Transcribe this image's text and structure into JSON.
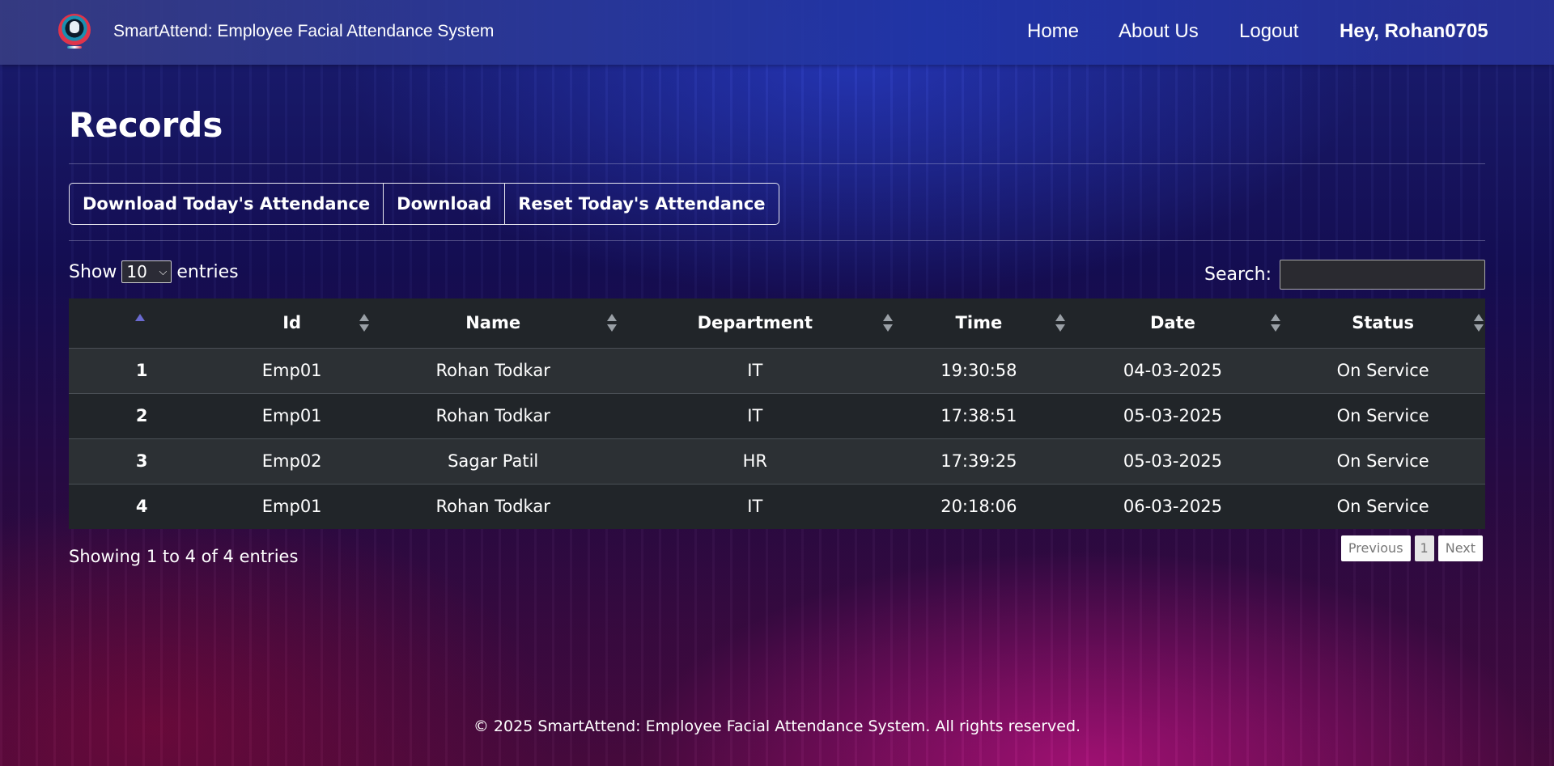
{
  "nav": {
    "brand": "SmartAttend: Employee Facial Attendance System",
    "links": [
      "Home",
      "About Us",
      "Logout"
    ],
    "greeting": "Hey, Rohan0705"
  },
  "page": {
    "title": "Records"
  },
  "actions": {
    "download_today": "Download Today's Attendance",
    "download": "Download",
    "reset_today": "Reset Today's Attendance"
  },
  "table_controls": {
    "show_label": "Show",
    "entries_value": "10",
    "entries_label": "entries",
    "search_label": "Search:"
  },
  "table": {
    "columns": [
      "",
      "Id",
      "Name",
      "Department",
      "Time",
      "Date",
      "Status"
    ],
    "rows": [
      [
        "1",
        "Emp01",
        "Rohan Todkar",
        "IT",
        "19:30:58",
        "04-03-2025",
        "On Service"
      ],
      [
        "2",
        "Emp01",
        "Rohan Todkar",
        "IT",
        "17:38:51",
        "05-03-2025",
        "On Service"
      ],
      [
        "3",
        "Emp02",
        "Sagar Patil",
        "HR",
        "17:39:25",
        "05-03-2025",
        "On Service"
      ],
      [
        "4",
        "Emp01",
        "Rohan Todkar",
        "IT",
        "20:18:06",
        "06-03-2025",
        "On Service"
      ]
    ]
  },
  "pagination": {
    "info": "Showing 1 to 4 of 4 entries",
    "previous": "Previous",
    "current": "1",
    "next": "Next"
  },
  "footer": {
    "text": "© 2025 SmartAttend: Employee Facial Attendance System. All rights reserved."
  }
}
